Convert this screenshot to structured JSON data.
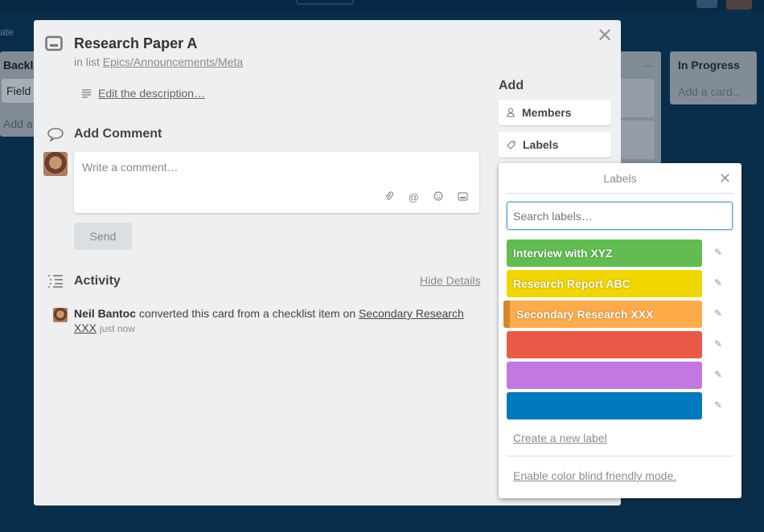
{
  "background": {
    "partial_text": "ate",
    "list_left": {
      "title": "Backl",
      "card": "Field",
      "add": "Add a"
    },
    "list_mid": {
      "menu": "..."
    },
    "list_right": {
      "title": "In Progress",
      "add": "Add a card..."
    }
  },
  "card": {
    "title": "Research Paper A",
    "in_list_prefix": "in list ",
    "list_name": "Epics/Announcements/Meta",
    "edit_description": "Edit the description…",
    "add_comment_heading": "Add Comment",
    "comment_placeholder": "Write a comment…",
    "send_label": "Send",
    "activity_heading": "Activity",
    "hide_details": "Hide Details",
    "activity": {
      "user": "Neil Bantoc",
      "text": " converted this card from a checklist item on ",
      "link": "Secondary Research XXX",
      "time": "just now"
    }
  },
  "sidebar": {
    "add_heading": "Add",
    "members_label": "Members",
    "labels_label": "Labels"
  },
  "labels_popover": {
    "title": "Labels",
    "search_placeholder": "Search labels…",
    "labels": [
      {
        "name": "Interview with XYZ",
        "color": "#61bd4f",
        "selected": false
      },
      {
        "name": "Research Report ABC",
        "color": "#f2d600",
        "selected": false
      },
      {
        "name": "Secondary Research XXX",
        "color": "#ffab4a",
        "selected": true
      },
      {
        "name": "",
        "color": "#eb5a46",
        "selected": false
      },
      {
        "name": "",
        "color": "#c377e0",
        "selected": false
      },
      {
        "name": "",
        "color": "#0079bf",
        "selected": false
      }
    ],
    "create_label": "Create a new label",
    "color_blind": "Enable color blind friendly mode."
  },
  "icons": {
    "close": "close-icon",
    "card": "card-icon",
    "description": "description-lines-icon",
    "comment": "speech-bubble-icon",
    "activity": "activity-list-icon",
    "attach": "paperclip-icon",
    "mention": "at-icon",
    "emoji": "smiley-icon",
    "card_attach": "card-attach-icon",
    "members": "person-icon",
    "labels": "tag-icon",
    "edit": "pencil-icon"
  }
}
